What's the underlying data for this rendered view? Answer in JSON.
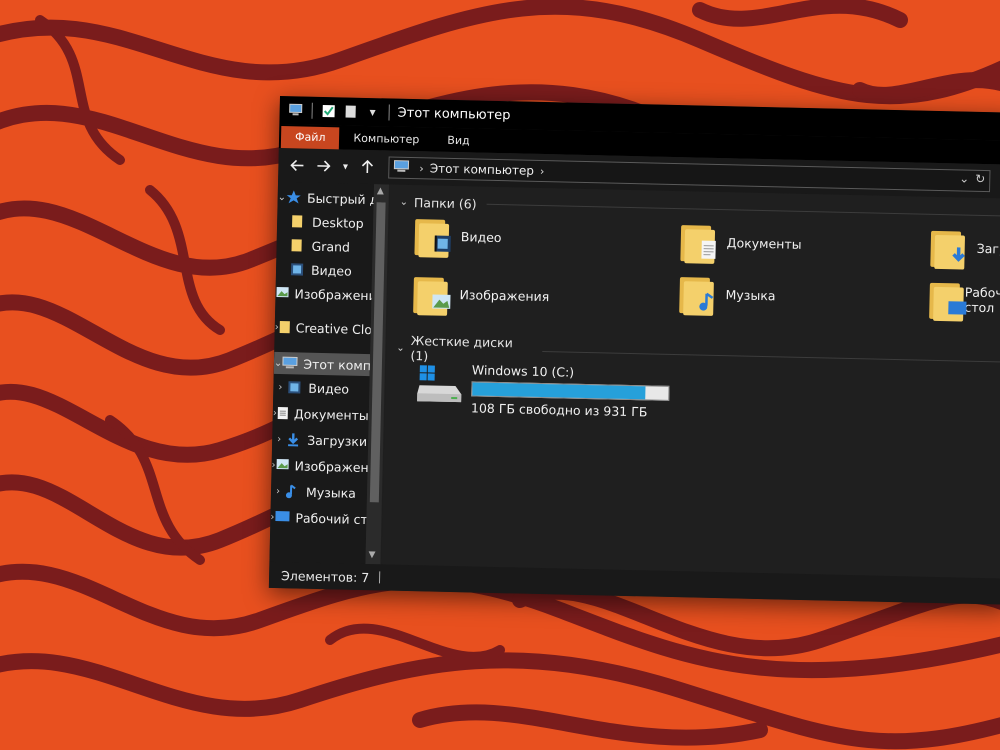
{
  "window": {
    "title": "Этот компьютер"
  },
  "ribbon": {
    "tabs": [
      "Файл",
      "Компьютер",
      "Вид"
    ]
  },
  "navigation": {
    "back_icon": "arrow-left-icon",
    "forward_icon": "arrow-right-icon",
    "up_icon": "arrow-up-icon"
  },
  "address": {
    "location": "Этот компьютер"
  },
  "sidebar": {
    "items": [
      {
        "label": "Быстрый доступ",
        "icon": "star-icon"
      },
      {
        "label": "Desktop",
        "icon": "folder-icon"
      },
      {
        "label": "Grand",
        "icon": "folder-icon"
      },
      {
        "label": "Видео",
        "icon": "video-icon"
      },
      {
        "label": "Изображения",
        "icon": "image-icon"
      },
      {
        "label": "Creative Cloud Files",
        "icon": "folder-icon"
      },
      {
        "label": "Этот компьютер",
        "icon": "computer-icon"
      },
      {
        "label": "Видео",
        "icon": "video-icon"
      },
      {
        "label": "Документы",
        "icon": "document-icon"
      },
      {
        "label": "Загрузки",
        "icon": "download-icon"
      },
      {
        "label": "Изображения",
        "icon": "image-icon"
      },
      {
        "label": "Музыка",
        "icon": "music-icon"
      },
      {
        "label": "Рабочий стол",
        "icon": "desktop-icon"
      }
    ]
  },
  "folders_group": {
    "heading": "Папки (6)",
    "items": [
      {
        "label": "Видео",
        "icon": "video-folder-icon"
      },
      {
        "label": "Документы",
        "icon": "documents-folder-icon"
      },
      {
        "label": "Загрузки",
        "icon": "downloads-folder-icon"
      },
      {
        "label": "Изображения",
        "icon": "pictures-folder-icon"
      },
      {
        "label": "Музыка",
        "icon": "music-folder-icon"
      },
      {
        "label": "Рабочий стол",
        "icon": "desktop-folder-icon"
      }
    ]
  },
  "drives_group": {
    "heading": "Жесткие диски (1)",
    "drive": {
      "name": "Windows 10 (C:)",
      "free_text": "108 ГБ свободно из 931 ГБ",
      "used_fraction": 0.884
    }
  },
  "status_bar": {
    "items_count": "Элементов: 7"
  },
  "colors": {
    "wallpaper_orange": "#e8501f",
    "wallpaper_stripes": "#7a1c1c",
    "file_tab": "#c8461f",
    "progress_fill": "#26a0da",
    "folder_yellow": "#f4d06b"
  }
}
